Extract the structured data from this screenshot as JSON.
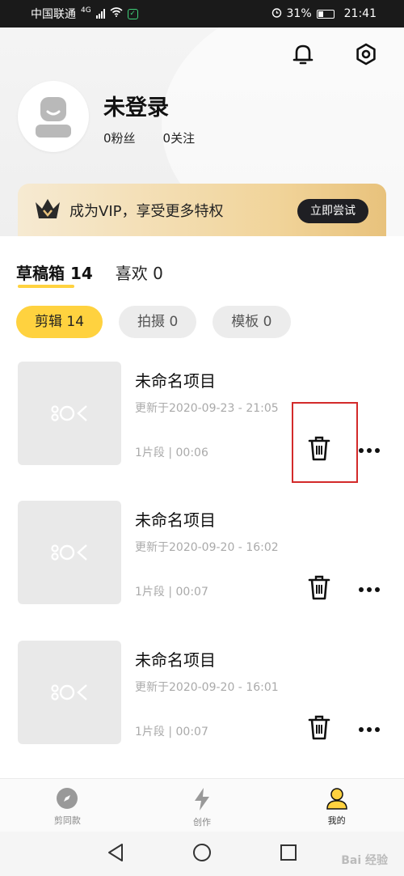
{
  "status_bar": {
    "carrier": "中国联通",
    "network": "4G",
    "battery": "31%",
    "time": "21:41"
  },
  "profile": {
    "username": "未登录",
    "fans": "0粉丝",
    "following": "0关注"
  },
  "vip": {
    "text": "成为VIP，享受更多特权",
    "button": "立即尝试"
  },
  "tabs": [
    {
      "label": "草稿箱 14",
      "active": true
    },
    {
      "label": "喜欢 0",
      "active": false
    }
  ],
  "chips": [
    {
      "label": "剪辑 14",
      "active": true
    },
    {
      "label": "拍摄 0",
      "active": false
    },
    {
      "label": "模板 0",
      "active": false
    }
  ],
  "drafts": [
    {
      "title": "未命名项目",
      "updated": "更新于2020-09-23 - 21:05",
      "meta": "1片段 | 00:06"
    },
    {
      "title": "未命名项目",
      "updated": "更新于2020-09-20 - 16:02",
      "meta": "1片段 | 00:07"
    },
    {
      "title": "未命名项目",
      "updated": "更新于2020-09-20 - 16:01",
      "meta": "1片段 | 00:07"
    }
  ],
  "bottom_nav": [
    {
      "label": "剪同款",
      "icon": "compass-icon"
    },
    {
      "label": "创作",
      "icon": "lightning-icon"
    },
    {
      "label": "我的",
      "icon": "user-icon",
      "active": true
    }
  ],
  "watermark": "Bai 经验",
  "colors": {
    "accent": "#ffd23f",
    "highlight": "#d32a2a"
  }
}
